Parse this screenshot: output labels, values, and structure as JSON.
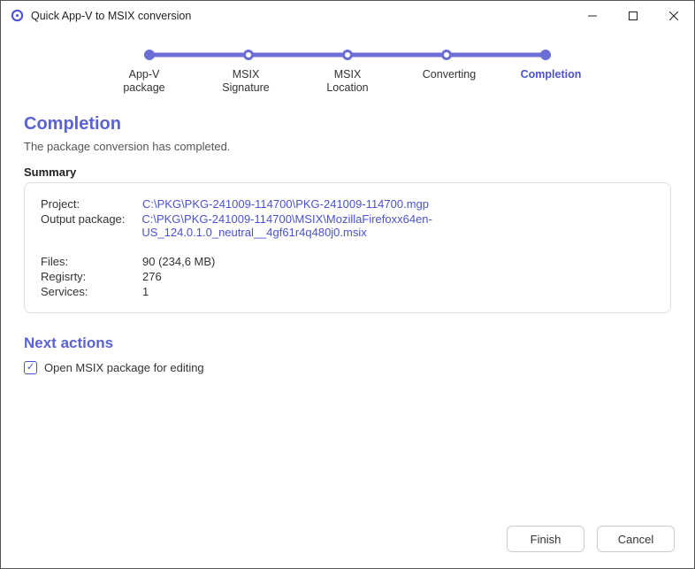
{
  "window": {
    "title": "Quick App-V to MSIX conversion"
  },
  "stepper": {
    "items": [
      {
        "label": "App-V package",
        "active": false,
        "filled": true
      },
      {
        "label": "MSIX Signature",
        "active": false,
        "filled": false
      },
      {
        "label": "MSIX Location",
        "active": false,
        "filled": false
      },
      {
        "label": "Converting",
        "active": false,
        "filled": false
      },
      {
        "label": "Completion",
        "active": true,
        "filled": true
      }
    ]
  },
  "page": {
    "title": "Completion",
    "description": "The package conversion has completed."
  },
  "summary": {
    "heading": "Summary",
    "rows": [
      {
        "label": "Project:",
        "value": "C:\\PKG\\PKG-241009-114700\\PKG-241009-114700.mgp",
        "link": true
      },
      {
        "label": "Output package:",
        "value": "C:\\PKG\\PKG-241009-114700\\MSIX\\MozillaFirefoxx64en-US_124.0.1.0_neutral__4gf61r4q480j0.msix",
        "link": true
      }
    ],
    "stats": [
      {
        "label": "Files:",
        "value": "90 (234,6 MB)"
      },
      {
        "label": "Regisrty:",
        "value": "276"
      },
      {
        "label": "Services:",
        "value": "1"
      }
    ]
  },
  "next_actions": {
    "heading": "Next actions",
    "open_msix": {
      "label": "Open MSIX package for editing",
      "checked": true
    }
  },
  "footer": {
    "finish": "Finish",
    "cancel": "Cancel"
  }
}
